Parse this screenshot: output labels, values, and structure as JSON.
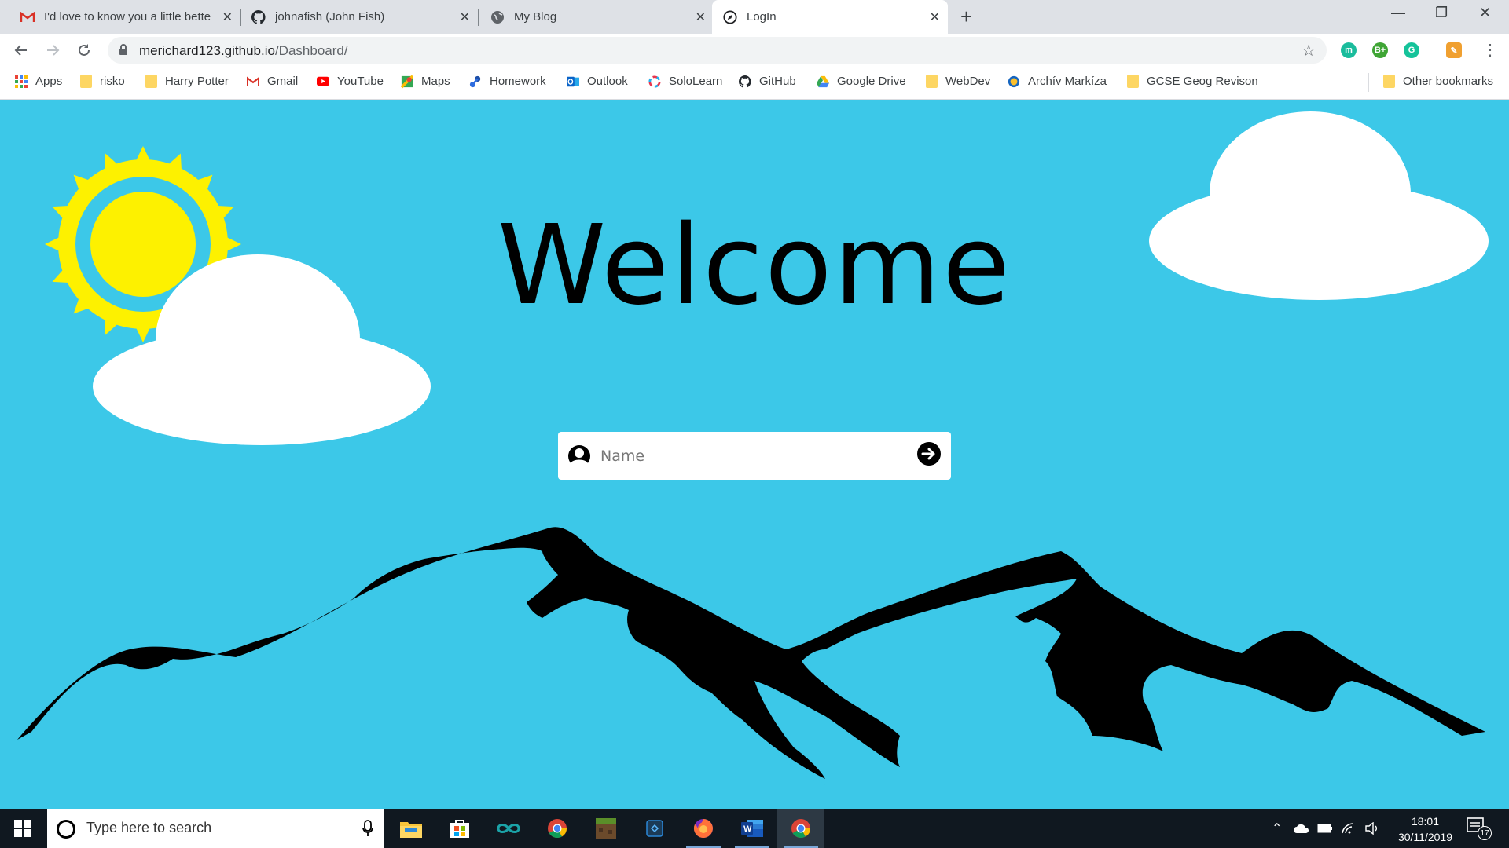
{
  "browser": {
    "tabs": [
      {
        "title": "I'd love to know you a little bette",
        "icon": "gmail-icon"
      },
      {
        "title": "johnafish (John Fish)",
        "icon": "github-icon"
      },
      {
        "title": "My Blog",
        "icon": "globe-icon"
      },
      {
        "title": "LogIn",
        "icon": "compass-icon",
        "active": true
      }
    ],
    "url_host": "merichard123.github.io",
    "url_path": "/Dashboard/",
    "bookmarks": [
      {
        "label": "Apps",
        "icon": "apps-grid-icon"
      },
      {
        "label": "risko",
        "icon": "folder-icon"
      },
      {
        "label": "Harry Potter",
        "icon": "folder-icon"
      },
      {
        "label": "Gmail",
        "icon": "gmail-icon"
      },
      {
        "label": "YouTube",
        "icon": "youtube-icon"
      },
      {
        "label": "Maps",
        "icon": "maps-icon"
      },
      {
        "label": "Homework",
        "icon": "homework-icon"
      },
      {
        "label": "Outlook",
        "icon": "outlook-icon"
      },
      {
        "label": "SoloLearn",
        "icon": "sololearn-icon"
      },
      {
        "label": "GitHub",
        "icon": "github-icon"
      },
      {
        "label": "Google Drive",
        "icon": "drive-icon"
      },
      {
        "label": "WebDev",
        "icon": "folder-icon"
      },
      {
        "label": "Archív Markíza",
        "icon": "markiza-icon"
      },
      {
        "label": "GCSE Geog Revison",
        "icon": "folder-icon"
      }
    ],
    "other_bookmarks": "Other bookmarks"
  },
  "page": {
    "heading": "Welcome",
    "name_placeholder": "Name",
    "colors": {
      "sky": "#3cc8e8",
      "sun": "#fdf100",
      "cloud": "#ffffff",
      "mountains": "#000000"
    }
  },
  "taskbar": {
    "search_placeholder": "Type here to search",
    "time": "18:01",
    "date": "30/11/2019",
    "notification_count": "17"
  }
}
